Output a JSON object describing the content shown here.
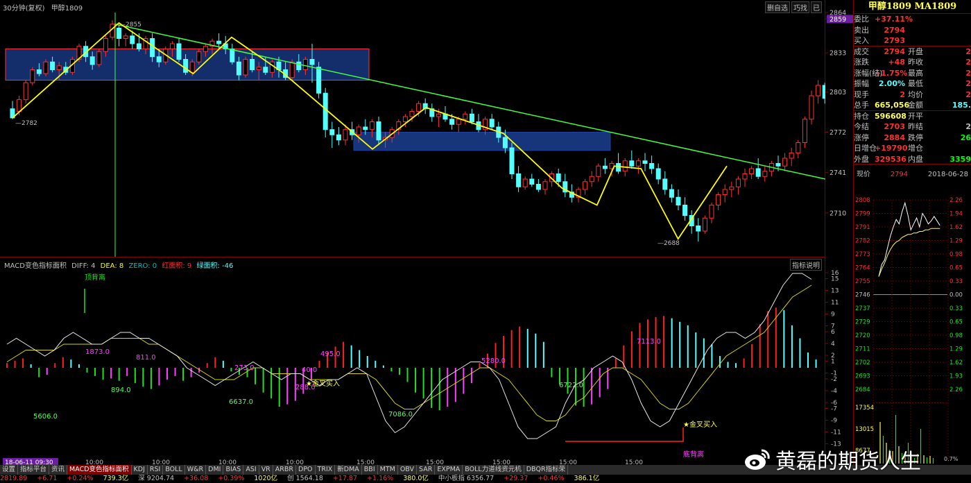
{
  "main_chart": {
    "title_period": "30分钟(复权)",
    "title_symbol": "甲醇1809",
    "buttons": [
      "删自选",
      "巧找",
      "已"
    ],
    "axis_ticks": [
      {
        "v": 2864,
        "label": "2864"
      },
      {
        "v": 2859,
        "label": "2859",
        "highlight": true
      },
      {
        "v": 2833,
        "label": "2833"
      },
      {
        "v": 2803,
        "label": "2803"
      },
      {
        "v": 2772,
        "label": "2772"
      },
      {
        "v": 2741,
        "label": "2741"
      },
      {
        "v": 2710,
        "label": "2710"
      }
    ],
    "annotations": {
      "high_label": "2855",
      "low1_label": "2782",
      "low2_label": "2688"
    },
    "candles": [
      [
        2790,
        2796,
        2782,
        2783
      ],
      [
        2788,
        2800,
        2785,
        2797
      ],
      [
        2797,
        2812,
        2794,
        2810
      ],
      [
        2810,
        2822,
        2808,
        2820
      ],
      [
        2820,
        2825,
        2815,
        2817
      ],
      [
        2817,
        2828,
        2815,
        2826
      ],
      [
        2826,
        2830,
        2818,
        2820
      ],
      [
        2820,
        2826,
        2812,
        2823
      ],
      [
        2822,
        2826,
        2816,
        2818
      ],
      [
        2818,
        2830,
        2816,
        2828
      ],
      [
        2828,
        2840,
        2826,
        2838
      ],
      [
        2838,
        2842,
        2826,
        2830
      ],
      [
        2830,
        2834,
        2820,
        2824
      ],
      [
        2824,
        2836,
        2822,
        2834
      ],
      [
        2834,
        2846,
        2830,
        2844
      ],
      [
        2845,
        2858,
        2843,
        2855
      ],
      [
        2852,
        2854,
        2838,
        2844
      ],
      [
        2844,
        2848,
        2838,
        2846
      ],
      [
        2846,
        2850,
        2836,
        2840
      ],
      [
        2840,
        2848,
        2834,
        2836
      ],
      [
        2836,
        2846,
        2832,
        2844
      ],
      [
        2844,
        2848,
        2826,
        2830
      ],
      [
        2830,
        2836,
        2822,
        2826
      ],
      [
        2826,
        2838,
        2824,
        2836
      ],
      [
        2836,
        2842,
        2830,
        2840
      ],
      [
        2840,
        2844,
        2826,
        2828
      ],
      [
        2828,
        2832,
        2816,
        2818
      ],
      [
        2818,
        2828,
        2815,
        2826
      ],
      [
        2826,
        2836,
        2824,
        2834
      ],
      [
        2834,
        2840,
        2830,
        2838
      ],
      [
        2838,
        2844,
        2832,
        2842
      ],
      [
        2842,
        2848,
        2836,
        2840
      ],
      [
        2840,
        2846,
        2832,
        2836
      ],
      [
        2836,
        2840,
        2824,
        2826
      ],
      [
        2826,
        2830,
        2812,
        2816
      ],
      [
        2816,
        2830,
        2814,
        2828
      ],
      [
        2828,
        2834,
        2818,
        2820
      ],
      [
        2820,
        2826,
        2812,
        2822
      ],
      [
        2822,
        2830,
        2816,
        2818
      ],
      [
        2818,
        2828,
        2814,
        2826
      ],
      [
        2826,
        2830,
        2814,
        2820
      ],
      [
        2820,
        2826,
        2812,
        2814
      ],
      [
        2814,
        2828,
        2812,
        2826
      ],
      [
        2826,
        2832,
        2818,
        2820
      ],
      [
        2820,
        2830,
        2816,
        2828
      ],
      [
        2828,
        2840,
        2810,
        2824
      ],
      [
        2822,
        2826,
        2798,
        2802
      ],
      [
        2802,
        2806,
        2768,
        2774
      ],
      [
        2774,
        2780,
        2760,
        2770
      ],
      [
        2770,
        2776,
        2762,
        2766
      ],
      [
        2766,
        2778,
        2762,
        2774
      ],
      [
        2774,
        2780,
        2766,
        2770
      ],
      [
        2770,
        2778,
        2764,
        2776
      ],
      [
        2776,
        2782,
        2770,
        2774
      ],
      [
        2774,
        2782,
        2768,
        2780
      ],
      [
        2780,
        2784,
        2762,
        2766
      ],
      [
        2766,
        2772,
        2760,
        2768
      ],
      [
        2768,
        2776,
        2764,
        2774
      ],
      [
        2774,
        2782,
        2770,
        2780
      ],
      [
        2780,
        2786,
        2776,
        2784
      ],
      [
        2784,
        2790,
        2780,
        2788
      ],
      [
        2788,
        2796,
        2784,
        2794
      ],
      [
        2794,
        2798,
        2786,
        2790
      ],
      [
        2790,
        2794,
        2780,
        2784
      ],
      [
        2784,
        2790,
        2776,
        2786
      ],
      [
        2786,
        2792,
        2780,
        2782
      ],
      [
        2782,
        2786,
        2774,
        2778
      ],
      [
        2778,
        2784,
        2772,
        2782
      ],
      [
        2782,
        2788,
        2778,
        2786
      ],
      [
        2786,
        2790,
        2778,
        2780
      ],
      [
        2780,
        2786,
        2772,
        2774
      ],
      [
        2774,
        2784,
        2770,
        2782
      ],
      [
        2782,
        2786,
        2774,
        2776
      ],
      [
        2776,
        2780,
        2764,
        2768
      ],
      [
        2768,
        2774,
        2756,
        2760
      ],
      [
        2760,
        2764,
        2736,
        2740
      ],
      [
        2740,
        2746,
        2726,
        2730
      ],
      [
        2730,
        2738,
        2728,
        2736
      ],
      [
        2736,
        2740,
        2730,
        2732
      ],
      [
        2732,
        2736,
        2726,
        2728
      ],
      [
        2728,
        2736,
        2724,
        2734
      ],
      [
        2734,
        2742,
        2730,
        2740
      ],
      [
        2740,
        2744,
        2730,
        2734
      ],
      [
        2734,
        2740,
        2722,
        2726
      ],
      [
        2726,
        2732,
        2718,
        2722
      ],
      [
        2722,
        2730,
        2718,
        2728
      ],
      [
        2728,
        2736,
        2724,
        2734
      ],
      [
        2734,
        2742,
        2730,
        2738
      ],
      [
        2738,
        2748,
        2734,
        2746
      ],
      [
        2746,
        2752,
        2740,
        2744
      ],
      [
        2744,
        2750,
        2738,
        2748
      ],
      [
        2748,
        2756,
        2740,
        2742
      ],
      [
        2742,
        2752,
        2738,
        2750
      ],
      [
        2750,
        2758,
        2744,
        2746
      ],
      [
        2746,
        2752,
        2740,
        2750
      ],
      [
        2750,
        2756,
        2742,
        2748
      ],
      [
        2748,
        2754,
        2740,
        2744
      ],
      [
        2744,
        2748,
        2732,
        2736
      ],
      [
        2736,
        2742,
        2724,
        2728
      ],
      [
        2728,
        2732,
        2718,
        2722
      ],
      [
        2722,
        2728,
        2712,
        2716
      ],
      [
        2716,
        2722,
        2704,
        2708
      ],
      [
        2708,
        2712,
        2694,
        2700
      ],
      [
        2700,
        2706,
        2688,
        2696
      ],
      [
        2696,
        2708,
        2694,
        2706
      ],
      [
        2706,
        2718,
        2702,
        2716
      ],
      [
        2716,
        2726,
        2712,
        2724
      ],
      [
        2724,
        2732,
        2718,
        2728
      ],
      [
        2728,
        2734,
        2722,
        2730
      ],
      [
        2730,
        2738,
        2724,
        2736
      ],
      [
        2736,
        2744,
        2730,
        2740
      ],
      [
        2740,
        2746,
        2736,
        2744
      ],
      [
        2744,
        2752,
        2736,
        2738
      ],
      [
        2738,
        2746,
        2734,
        2742
      ],
      [
        2742,
        2750,
        2738,
        2748
      ],
      [
        2748,
        2754,
        2742,
        2746
      ],
      [
        2746,
        2756,
        2742,
        2752
      ],
      [
        2752,
        2760,
        2746,
        2756
      ],
      [
        2756,
        2766,
        2752,
        2764
      ],
      [
        2764,
        2784,
        2760,
        2782
      ],
      [
        2782,
        2804,
        2778,
        2800
      ],
      [
        2800,
        2812,
        2794,
        2808
      ],
      [
        2808,
        2810,
        2794,
        2798
      ],
      [
        2798,
        2806,
        2792,
        2802
      ],
      [
        2802,
        2808,
        2796,
        2800
      ],
      [
        2800,
        2804,
        2792,
        2794
      ]
    ]
  },
  "macd": {
    "legend": {
      "name": "MACD变色指标面积",
      "diff": "DIFF: 4",
      "dea": "DEA: 8",
      "zero": "ZERO: 0",
      "red_area": "红面积: 9",
      "green_area": "绿面积: -46"
    },
    "indicator_help": "指标说明",
    "axis_ticks": [
      "16",
      "15",
      "13",
      "11",
      "9",
      "7",
      "6",
      "4",
      "2",
      "1",
      "-1",
      "-2",
      "-4",
      "-6",
      "-7",
      "-9",
      "-11",
      "-13"
    ],
    "area_labels": [
      "1873.0",
      "811.0",
      "894.0",
      "5606.0",
      "6637.0",
      "495.0",
      "5280.0",
      "7086.0",
      "6722.0",
      "7113.0",
      "40.0",
      "288.0",
      "273.0"
    ],
    "text_labels": {
      "top_div": "顶背离",
      "bottom_div": "底背离",
      "golden_cross_1": "金叉买入",
      "golden_cross_2": "金叉买入"
    },
    "diff": [
      4,
      5,
      4,
      3,
      2,
      3,
      5,
      6,
      5,
      4,
      4,
      5,
      6,
      6,
      5,
      5,
      4,
      3,
      2,
      0,
      -1,
      -2,
      -3,
      -2,
      -1,
      0,
      1,
      0,
      -1,
      -2,
      -1,
      -1,
      -2,
      -3,
      -2,
      -2,
      -1,
      0,
      -1,
      -5,
      -9,
      -11,
      -10,
      -8,
      -6,
      -4,
      -2,
      -1,
      0,
      1,
      1,
      0,
      -2,
      -6,
      -10,
      -12,
      -12,
      -11,
      -10,
      -6,
      -3,
      -2,
      0,
      1,
      2,
      1,
      -2,
      -6,
      -9,
      -10,
      -9,
      -6,
      -3,
      0,
      3,
      5,
      6,
      6,
      5,
      6,
      8,
      11,
      14,
      16,
      16,
      15
    ],
    "dea": [
      1,
      2,
      3,
      3,
      3,
      3,
      4,
      4,
      4,
      4,
      4,
      5,
      5,
      5,
      5,
      4,
      4,
      3,
      2,
      1,
      0,
      -1,
      -2,
      -2,
      -2,
      -1,
      0,
      0,
      -1,
      -1,
      -1,
      -1,
      -2,
      -2,
      -2,
      -2,
      -1,
      -1,
      -1,
      -2,
      -4,
      -6,
      -7,
      -7,
      -6,
      -5,
      -4,
      -3,
      -2,
      -1,
      0,
      0,
      -1,
      -2,
      -4,
      -6,
      -8,
      -9,
      -9,
      -8,
      -6,
      -5,
      -3,
      -1,
      0,
      0,
      -1,
      -2,
      -4,
      -6,
      -7,
      -7,
      -6,
      -4,
      -2,
      0,
      2,
      3,
      4,
      5,
      6,
      8,
      10,
      12,
      13,
      14
    ],
    "histogram": [
      0.8,
      1.2,
      1.6,
      0.6,
      -1.6,
      -1.2,
      0.8,
      1.8,
      1.4,
      0.6,
      -0.8,
      -1.4,
      -2,
      -1.8,
      -2.2,
      -1.4,
      -2.6,
      -3.2,
      -3.6,
      -3,
      -2,
      -1.4,
      -2.2,
      -1.6,
      -0.8,
      0.8,
      1.8,
      1.2,
      -0.6,
      -1.2,
      -1.6,
      -2.8,
      -4.2,
      -5.2,
      -6.6,
      -6.2,
      -5.6,
      -4.4,
      -2,
      1.2,
      2.6,
      3.6,
      4.4,
      3.8,
      3,
      2,
      1.2,
      0.4,
      -0.6,
      -1.2,
      -2.4,
      -4.2,
      -5.2,
      -6.8,
      -7.2,
      -6.6,
      -5.8,
      -4.4,
      -2.6,
      0.8,
      2.4,
      4.2,
      5.4,
      6.4,
      7,
      6.6,
      5.8,
      4.4,
      -1.6,
      -2.8,
      -4.4,
      -6.4,
      -6.6,
      -6.2,
      -5,
      -3.6,
      1.6,
      3.8,
      6.2,
      7.6,
      8.2,
      8.6,
      8.8,
      8.4,
      7.8,
      7.2,
      6,
      5,
      4,
      2,
      1,
      0.8,
      1.6,
      4,
      7.4,
      9.6,
      10.2,
      9.8,
      7.2,
      5,
      2.6,
      1.4
    ]
  },
  "time_axis": {
    "cursor_date": "18-06-11 09:30",
    "labels": [
      "10:00",
      "10:00",
      "10:00",
      "10:00",
      "15:00",
      "15:00",
      "15:00",
      "15:00",
      "15:00"
    ]
  },
  "quote": {
    "title": "甲醇1809 MA1809",
    "rows": [
      {
        "l1": "委比",
        "v1": "+37.11%",
        "c1": "#ff3030",
        "l2": "",
        "v2": "",
        "c2": "#ff3030"
      },
      {
        "l1": "卖出",
        "v1": "2794",
        "c1": "#ff3030",
        "l2": "",
        "v2": "",
        "c2": "#ff3030"
      },
      {
        "l1": "买入",
        "v1": "2793",
        "c1": "#ff3030",
        "l2": "",
        "v2": "",
        "c2": "#ff3030"
      },
      {
        "l1": "成交",
        "v1": "2794",
        "c1": "#ff3030",
        "l2": "开盘",
        "v2": "2",
        "c2": "#ff3030"
      },
      {
        "l1": "涨跌",
        "v1": "+48",
        "c1": "#ff3030",
        "l2": "昨收",
        "v2": "2",
        "c2": "#ff3030"
      },
      {
        "l1": "涨幅(结)",
        "v1": "+1.75%",
        "c1": "#ff3030",
        "l2": "最高",
        "v2": "2",
        "c2": "#ff3030"
      },
      {
        "l1": "振幅",
        "v1": "2.00%",
        "c1": "#54ffff",
        "l2": "最低",
        "v2": "2",
        "c2": "#ff3030"
      },
      {
        "l1": "现手",
        "v1": "2",
        "c1": "#ff3030",
        "l2": "均价",
        "v2": "2",
        "c2": "#ff3030"
      },
      {
        "l1": "总手",
        "v1": "665,056",
        "c1": "#ffff54",
        "l2": "金额",
        "v2": "185.",
        "c2": "#54ffff"
      },
      {
        "l1": "持仓",
        "v1": "596608",
        "c1": "#ffff54",
        "l2": "开平",
        "v2": "",
        "c2": "#54ffff"
      },
      {
        "l1": "今结",
        "v1": "2703",
        "c1": "#ff3030",
        "l2": "昨结",
        "v2": "2",
        "c2": "#c0c0c0"
      },
      {
        "l1": "涨停",
        "v1": "2884",
        "c1": "#ff3030",
        "l2": "跌停",
        "v2": "26",
        "c2": "#00ff00"
      },
      {
        "l1": "日增仓",
        "v1": "+19790",
        "c1": "#ff3030",
        "l2": "增仓",
        "v2": "",
        "c2": "#ff3030"
      },
      {
        "l1": "外盘",
        "v1": "329536",
        "c1": "#ff3030",
        "l2": "内盘",
        "v2": "3359",
        "c2": "#00ff00"
      }
    ],
    "spot_label": "现价",
    "spot_value": "2794",
    "spot_date": "2018-06-28"
  },
  "mini_chart": {
    "price_ticks": [
      "2808",
      "2799",
      "2791",
      "2782",
      "2773",
      "2764",
      "2755",
      "2746",
      "2737",
      "2729",
      "2720",
      "2711",
      "2702",
      "2693",
      "2684"
    ],
    "pct_ticks": [
      "2.26",
      "1.94",
      "1.62",
      "1.29",
      "0.98",
      "0.65",
      "0.33",
      "0.00",
      "0.33",
      "0.65",
      "0.98",
      "1.29",
      "1.62",
      "1.93",
      "2.26"
    ],
    "volume_ticks": [
      "17354",
      "13015",
      "8677"
    ],
    "extra_label": "0.7%"
  },
  "bottom_tabs": [
    "设置",
    "指标平台",
    "资讯",
    "MACD变色指标面积",
    "KDJ",
    "RSI",
    "BOLL",
    "W&R",
    "DMI",
    "BIAS",
    "ASI",
    "VR",
    "ARBR",
    "DPO",
    "TRIX",
    "新DMA",
    "BBI",
    "MTM",
    "OBV",
    "SAR",
    "EXPMA",
    "BOLL力道线资元机",
    "DBQR指标荣"
  ],
  "status_bar": [
    {
      "text": "2819.89",
      "color": "#ff3030"
    },
    {
      "text": "+6.71",
      "color": "#ff3030"
    },
    {
      "text": "+0.24%",
      "color": "#ff3030"
    },
    {
      "text": "739.3亿",
      "color": "#ffff54"
    },
    {
      "text": "深 9204.74",
      "color": "#c0c0c0"
    },
    {
      "text": "+36.08",
      "color": "#ff3030"
    },
    {
      "text": "+0.39%",
      "color": "#ff3030"
    },
    {
      "text": "1020亿",
      "color": "#ffff54"
    },
    {
      "text": "创 1564.18",
      "color": "#c0c0c0"
    },
    {
      "text": "+17.87",
      "color": "#ff3030"
    },
    {
      "text": "+1.16%",
      "color": "#ff3030"
    },
    {
      "text": "380.0亿",
      "color": "#ffff54"
    },
    {
      "text": "中小板指 6356.77",
      "color": "#c0c0c0"
    },
    {
      "text": "+29.37",
      "color": "#ff3030"
    },
    {
      "text": "+0.46%",
      "color": "#ff3030"
    },
    {
      "text": "386.1亿",
      "color": "#ffff54"
    }
  ],
  "watermark": {
    "text": "黄磊的期货人生"
  },
  "colors": {
    "up": "#ff3030",
    "down": "#54ffff",
    "trend_green": "#40ff40",
    "zigzag": "#ffff00",
    "box_fill": "#1b3e8f"
  }
}
